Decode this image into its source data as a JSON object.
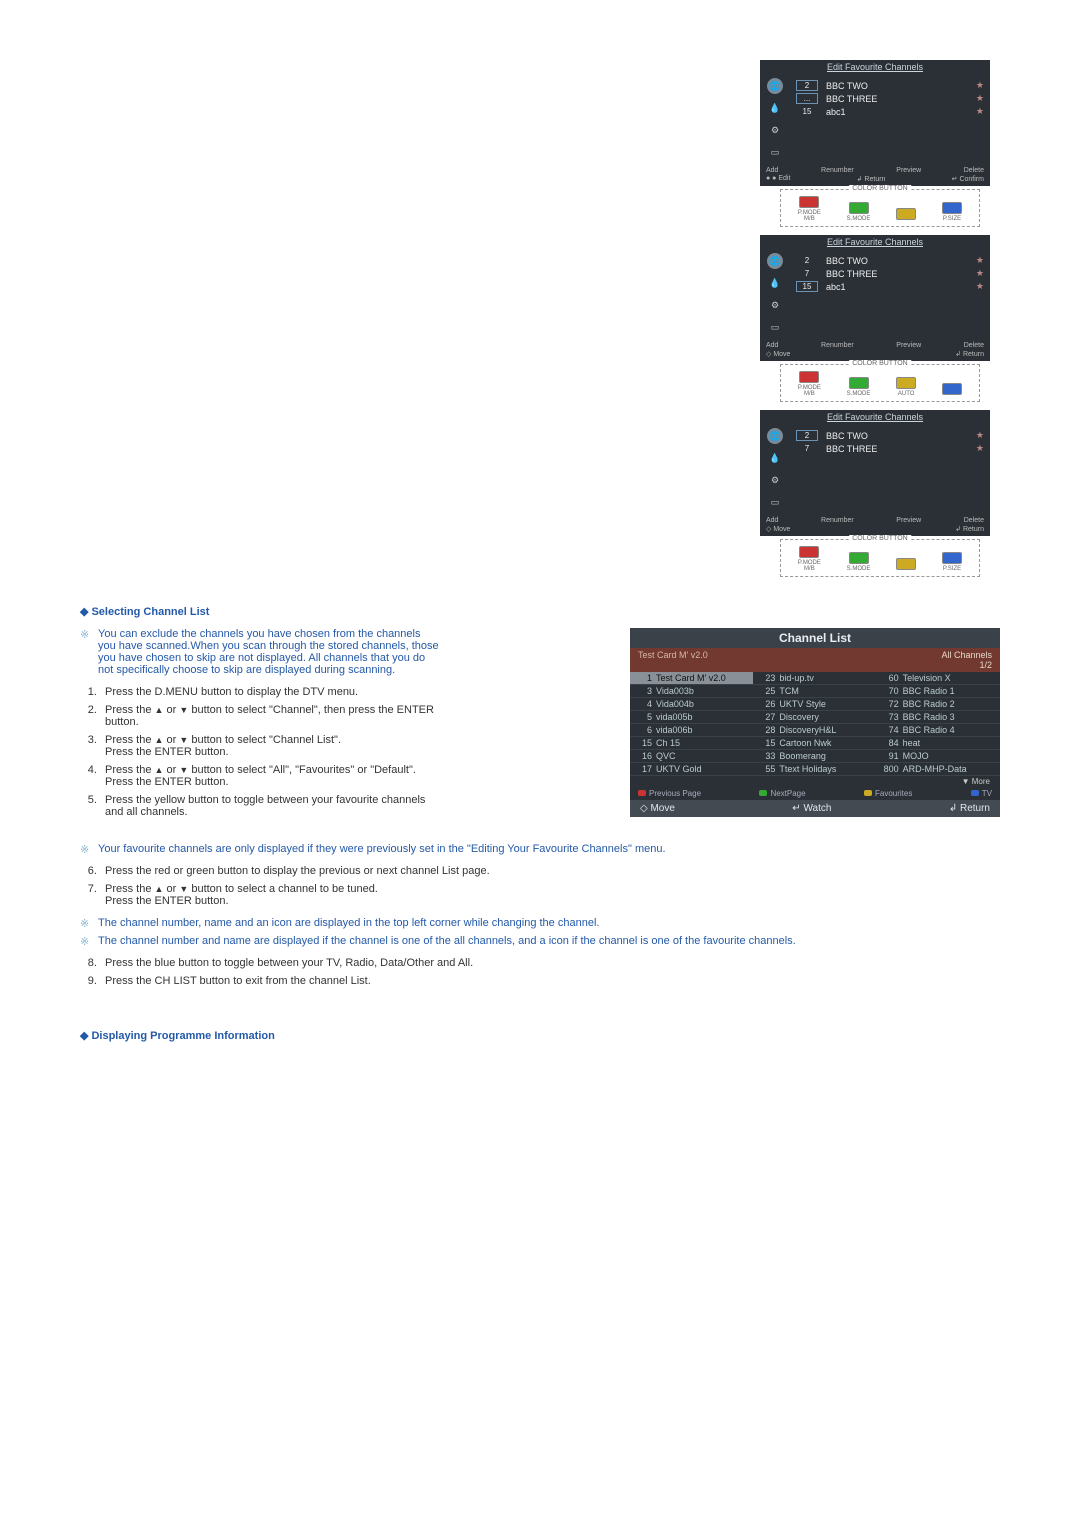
{
  "figures": {
    "editFav": {
      "title": "Edit Favourite Channels",
      "rows1": [
        {
          "num": "2",
          "boxed": true,
          "name": "BBC TWO",
          "star": true
        },
        {
          "num": "...",
          "boxed": true,
          "name": "BBC THREE",
          "star": true
        },
        {
          "num": "15",
          "name": "abc1",
          "star": true
        }
      ],
      "rows2": [
        {
          "num": "2",
          "name": "BBC TWO",
          "star": true
        },
        {
          "num": "7",
          "name": "BBC THREE",
          "star": true
        },
        {
          "num": "15",
          "boxed": true,
          "name": "abc1",
          "star": true
        }
      ],
      "rows3": [
        {
          "num": "2",
          "boxed": true,
          "name": "BBC TWO",
          "star": true
        },
        {
          "num": "7",
          "name": "BBC THREE",
          "star": true
        }
      ],
      "footLine1": {
        "add": "Add",
        "renumber": "Renumber",
        "preview": "Preview",
        "delete": "Delete"
      },
      "footLine2a": {
        "edit": "● ● Edit",
        "return": "↲ Return",
        "confirm": "↵ Confirm"
      },
      "footLine2b": {
        "move": "◇ Move",
        "return": "↲ Return"
      }
    },
    "colorButton": {
      "label": "COLOR BUTTON",
      "row1": [
        {
          "label": "P.MODE",
          "sub": "M/B",
          "cls": "red"
        },
        {
          "label": "S.MODE",
          "sub": "",
          "cls": "green"
        },
        {
          "label": "",
          "sub": "",
          "cls": "yellow"
        },
        {
          "label": "P.SIZE",
          "sub": "",
          "cls": "blue"
        }
      ],
      "row2": [
        {
          "label": "P.MODE",
          "sub": "M/B",
          "cls": "red"
        },
        {
          "label": "S.MODE",
          "sub": "",
          "cls": "green"
        },
        {
          "label": "AUTO",
          "sub": "",
          "cls": "yellow"
        },
        {
          "label": "",
          "sub": "",
          "cls": "blue"
        }
      ],
      "row3": [
        {
          "label": "P.MODE",
          "sub": "M/B",
          "cls": "red"
        },
        {
          "label": "S.MODE",
          "sub": "",
          "cls": "green"
        },
        {
          "label": "",
          "sub": "",
          "cls": "yellow"
        },
        {
          "label": "P.SIZE",
          "sub": "",
          "cls": "blue"
        }
      ]
    }
  },
  "section1": {
    "heading": "Selecting Channel List",
    "note1": "You can exclude the channels you have chosen from the channels you have scanned.When you scan through the stored channels, those you have chosen to skip are not displayed. All channels that you do not specifically choose to skip are displayed during scanning.",
    "steps": {
      "s1": "Press the D.MENU button to display the DTV menu.",
      "s2a": "Press the ",
      "s2b": " or ",
      "s2c": " button to select \"Channel\", then press the ENTER button.",
      "s3a": "Press the ",
      "s3b": " or ",
      "s3c": " button to select \"Channel List\".",
      "s3d": "Press the ENTER button.",
      "s4a": "Press the ",
      "s4b": " or ",
      "s4c": " button to select \"All\", \"Favourites\" or \"Default\".",
      "s4d": "Press the ENTER button.",
      "s5": "Press the yellow button to toggle between your favourite channels and all channels.",
      "note2": "Your favourite channels are only displayed if they were previously set in the \"Editing Your Favourite Channels\" menu.",
      "s6": "Press the red or green button to display the previous or next channel List page.",
      "s7a": "Press the ",
      "s7b": " or ",
      "s7c": " button to select a channel to be tuned.",
      "s7d": "Press the ENTER button.",
      "note3": "The channel number, name and an icon are displayed in the top left corner while changing the channel.",
      "note4": "The channel number and name are displayed if the channel is one of the all channels, and a icon if the channel is one of the favourite channels.",
      "s8": "Press the blue button to toggle between your TV, Radio, Data/Other and All.",
      "s9": "Press the CH LIST button to exit from the channel List."
    }
  },
  "channelList": {
    "title": "Channel List",
    "sub_left": "Test Card M' v2.0",
    "sub_right_top": "All Channels",
    "sub_right_bot": "1/2",
    "items": [
      {
        "n": "1",
        "name": "Test Card M' v2.0",
        "hl": true
      },
      {
        "n": "23",
        "name": "bid-up.tv"
      },
      {
        "n": "60",
        "name": "Television X"
      },
      {
        "n": "3",
        "name": "Vida003b"
      },
      {
        "n": "25",
        "name": "TCM"
      },
      {
        "n": "70",
        "name": "BBC Radio 1"
      },
      {
        "n": "4",
        "name": "Vida004b"
      },
      {
        "n": "26",
        "name": "UKTV Style"
      },
      {
        "n": "72",
        "name": "BBC Radio 2"
      },
      {
        "n": "5",
        "name": "vida005b"
      },
      {
        "n": "27",
        "name": "Discovery"
      },
      {
        "n": "73",
        "name": "BBC Radio 3"
      },
      {
        "n": "6",
        "name": "vida006b"
      },
      {
        "n": "28",
        "name": "DiscoveryH&L"
      },
      {
        "n": "74",
        "name": "BBC Radio 4"
      },
      {
        "n": "15",
        "name": "Ch 15"
      },
      {
        "n": "15",
        "name": "Cartoon Nwk"
      },
      {
        "n": "84",
        "name": "heat"
      },
      {
        "n": "16",
        "name": "QVC"
      },
      {
        "n": "33",
        "name": "Boomerang"
      },
      {
        "n": "91",
        "name": "MOJO"
      },
      {
        "n": "17",
        "name": "UKTV Gold"
      },
      {
        "n": "55",
        "name": "Ttext Holidays"
      },
      {
        "n": "800",
        "name": "ARD-MHP-Data"
      }
    ],
    "more": "▼ More",
    "legend": {
      "prev": "Previous Page",
      "next": "NextPage",
      "fav": "Favourites",
      "tv": "TV"
    },
    "bottom": {
      "move": "◇ Move",
      "watch": "↵ Watch",
      "return": "↲ Return"
    }
  },
  "section2": {
    "heading": "Displaying Programme Information"
  },
  "triangles": {
    "up": "▲",
    "down": "▼"
  }
}
